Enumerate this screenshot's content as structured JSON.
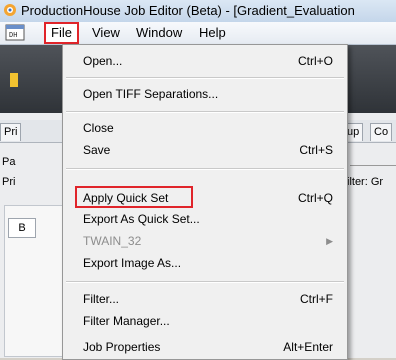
{
  "window": {
    "title": "ProductionHouse Job Editor (Beta) - [Gradient_Evaluation"
  },
  "menubar": {
    "items": [
      {
        "label": "File"
      },
      {
        "label": "View"
      },
      {
        "label": "Window"
      },
      {
        "label": "Help"
      }
    ]
  },
  "background": {
    "tabs": [
      "Pri",
      "tup",
      "Co"
    ],
    "labels": [
      "Pa",
      "Pri",
      "ilter: Gr",
      "B"
    ]
  },
  "file_menu": {
    "items": [
      {
        "label": "Open...",
        "shortcut": "Ctrl+O"
      },
      {
        "label": "Open TIFF Separations...",
        "shortcut": ""
      },
      {
        "label": "Close",
        "shortcut": ""
      },
      {
        "label": "Save",
        "shortcut": "Ctrl+S"
      },
      {
        "label": "Apply Quick Set",
        "shortcut": "Ctrl+Q"
      },
      {
        "label": "Export As Quick Set...",
        "shortcut": ""
      },
      {
        "label": "TWAIN_32",
        "shortcut": ""
      },
      {
        "label": "Export Image As...",
        "shortcut": ""
      },
      {
        "label": "Filter...",
        "shortcut": "Ctrl+F"
      },
      {
        "label": "Filter Manager...",
        "shortcut": ""
      },
      {
        "label": "Job Properties",
        "shortcut": "Alt+Enter"
      }
    ]
  },
  "colors": {
    "highlight": "#e0242a",
    "menu_bg": "#f0f0f0",
    "disabled_text": "#8d8d8d"
  },
  "icons": [
    "app-icon",
    "system-menu-icon",
    "submenu-arrow-icon"
  ]
}
